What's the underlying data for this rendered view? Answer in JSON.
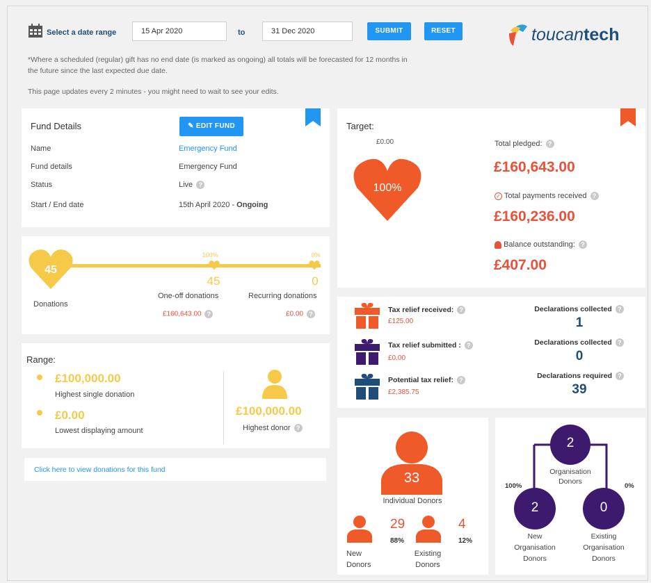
{
  "header": {
    "date_range_label": "Select a date range",
    "from_value": "15 Apr 2020",
    "to_label": "to",
    "to_value": "31 Dec 2020",
    "submit_label": "SUBMIT",
    "reset_label": "RESET",
    "note1": "*Where a scheduled (regular) gift has no end date (is marked as ongoing) all totals will be forecasted for 12 months in the future since the last expected due date.",
    "note2": "This page updates every 2 minutes - you might need to wait to see your edits.",
    "logo_prefix": "toucan",
    "logo_suffix": "tech"
  },
  "fund": {
    "title": "Fund Details",
    "edit_label": "EDIT FUND",
    "name_label": "Name",
    "name_value": "Emergency Fund",
    "details_label": "Fund details",
    "details_value": "Emergency Fund",
    "status_label": "Status",
    "status_value": "Live",
    "dates_label": "Start / End date",
    "dates_value_start": "15th April 2020 - ",
    "dates_value_end": "Ongoing"
  },
  "donations": {
    "count": "45",
    "label": "Donations",
    "oneoff_pct": "100%",
    "oneoff_count": "45",
    "oneoff_label": "One-off donations",
    "oneoff_amount": "£160,643.00",
    "recurring_pct": "0%",
    "recurring_count": "0",
    "recurring_label": "Recurring donations",
    "recurring_amount": "£0.00"
  },
  "range": {
    "title": "Range:",
    "highest_value": "£100,000.00",
    "highest_label": "Highest single donation",
    "lowest_value": "£0.00",
    "lowest_label": "Lowest displaying amount",
    "donor_value": "£100,000.00",
    "donor_label": "Highest donor"
  },
  "link": {
    "label": "Click here to view donations for this fund"
  },
  "target": {
    "title": "Target:",
    "target_amount": "£0.00",
    "heart_pct": "100%",
    "pledged_label": "Total pledged:",
    "pledged_value": "£160,643.00",
    "payments_label": "Total payments received",
    "payments_value": "£160,236.00",
    "balance_label": "Balance outstanding:",
    "balance_value": "£407.00"
  },
  "tax": {
    "received_label": "Tax relief received:",
    "received_value": "£125.00",
    "submitted_label": "Tax relief submitted :",
    "submitted_value": "£0.00",
    "potential_label": "Potential tax relief:",
    "potential_value": "£2,385.75",
    "decl1_label": "Declarations collected",
    "decl1_value": "1",
    "decl2_label": "Declarations collected",
    "decl2_value": "0",
    "decl3_label": "Declarations required",
    "decl3_value": "39"
  },
  "individual": {
    "count": "33",
    "label": "Individual Donors",
    "new_count": "29",
    "new_pct": "88%",
    "new_label1": "New",
    "new_label2": "Donors",
    "existing_count": "4",
    "existing_pct": "12%",
    "existing_label1": "Existing",
    "existing_label2": "Donors"
  },
  "organisation": {
    "count": "2",
    "label1": "Organisation",
    "label2": "Donors",
    "left_pct": "100%",
    "right_pct": "0%",
    "new_count": "2",
    "new_label1": "New",
    "new_label2": "Organisation",
    "new_label3": "Donors",
    "existing_count": "0",
    "existing_label1": "Existing",
    "existing_label2": "Organisation",
    "existing_label3": "Donors"
  },
  "colors": {
    "accent_blue": "#2196f3",
    "orange": "#f05a28",
    "yellow": "#f7c948",
    "purple": "#3d1a6e",
    "navy": "#1e4e79"
  }
}
